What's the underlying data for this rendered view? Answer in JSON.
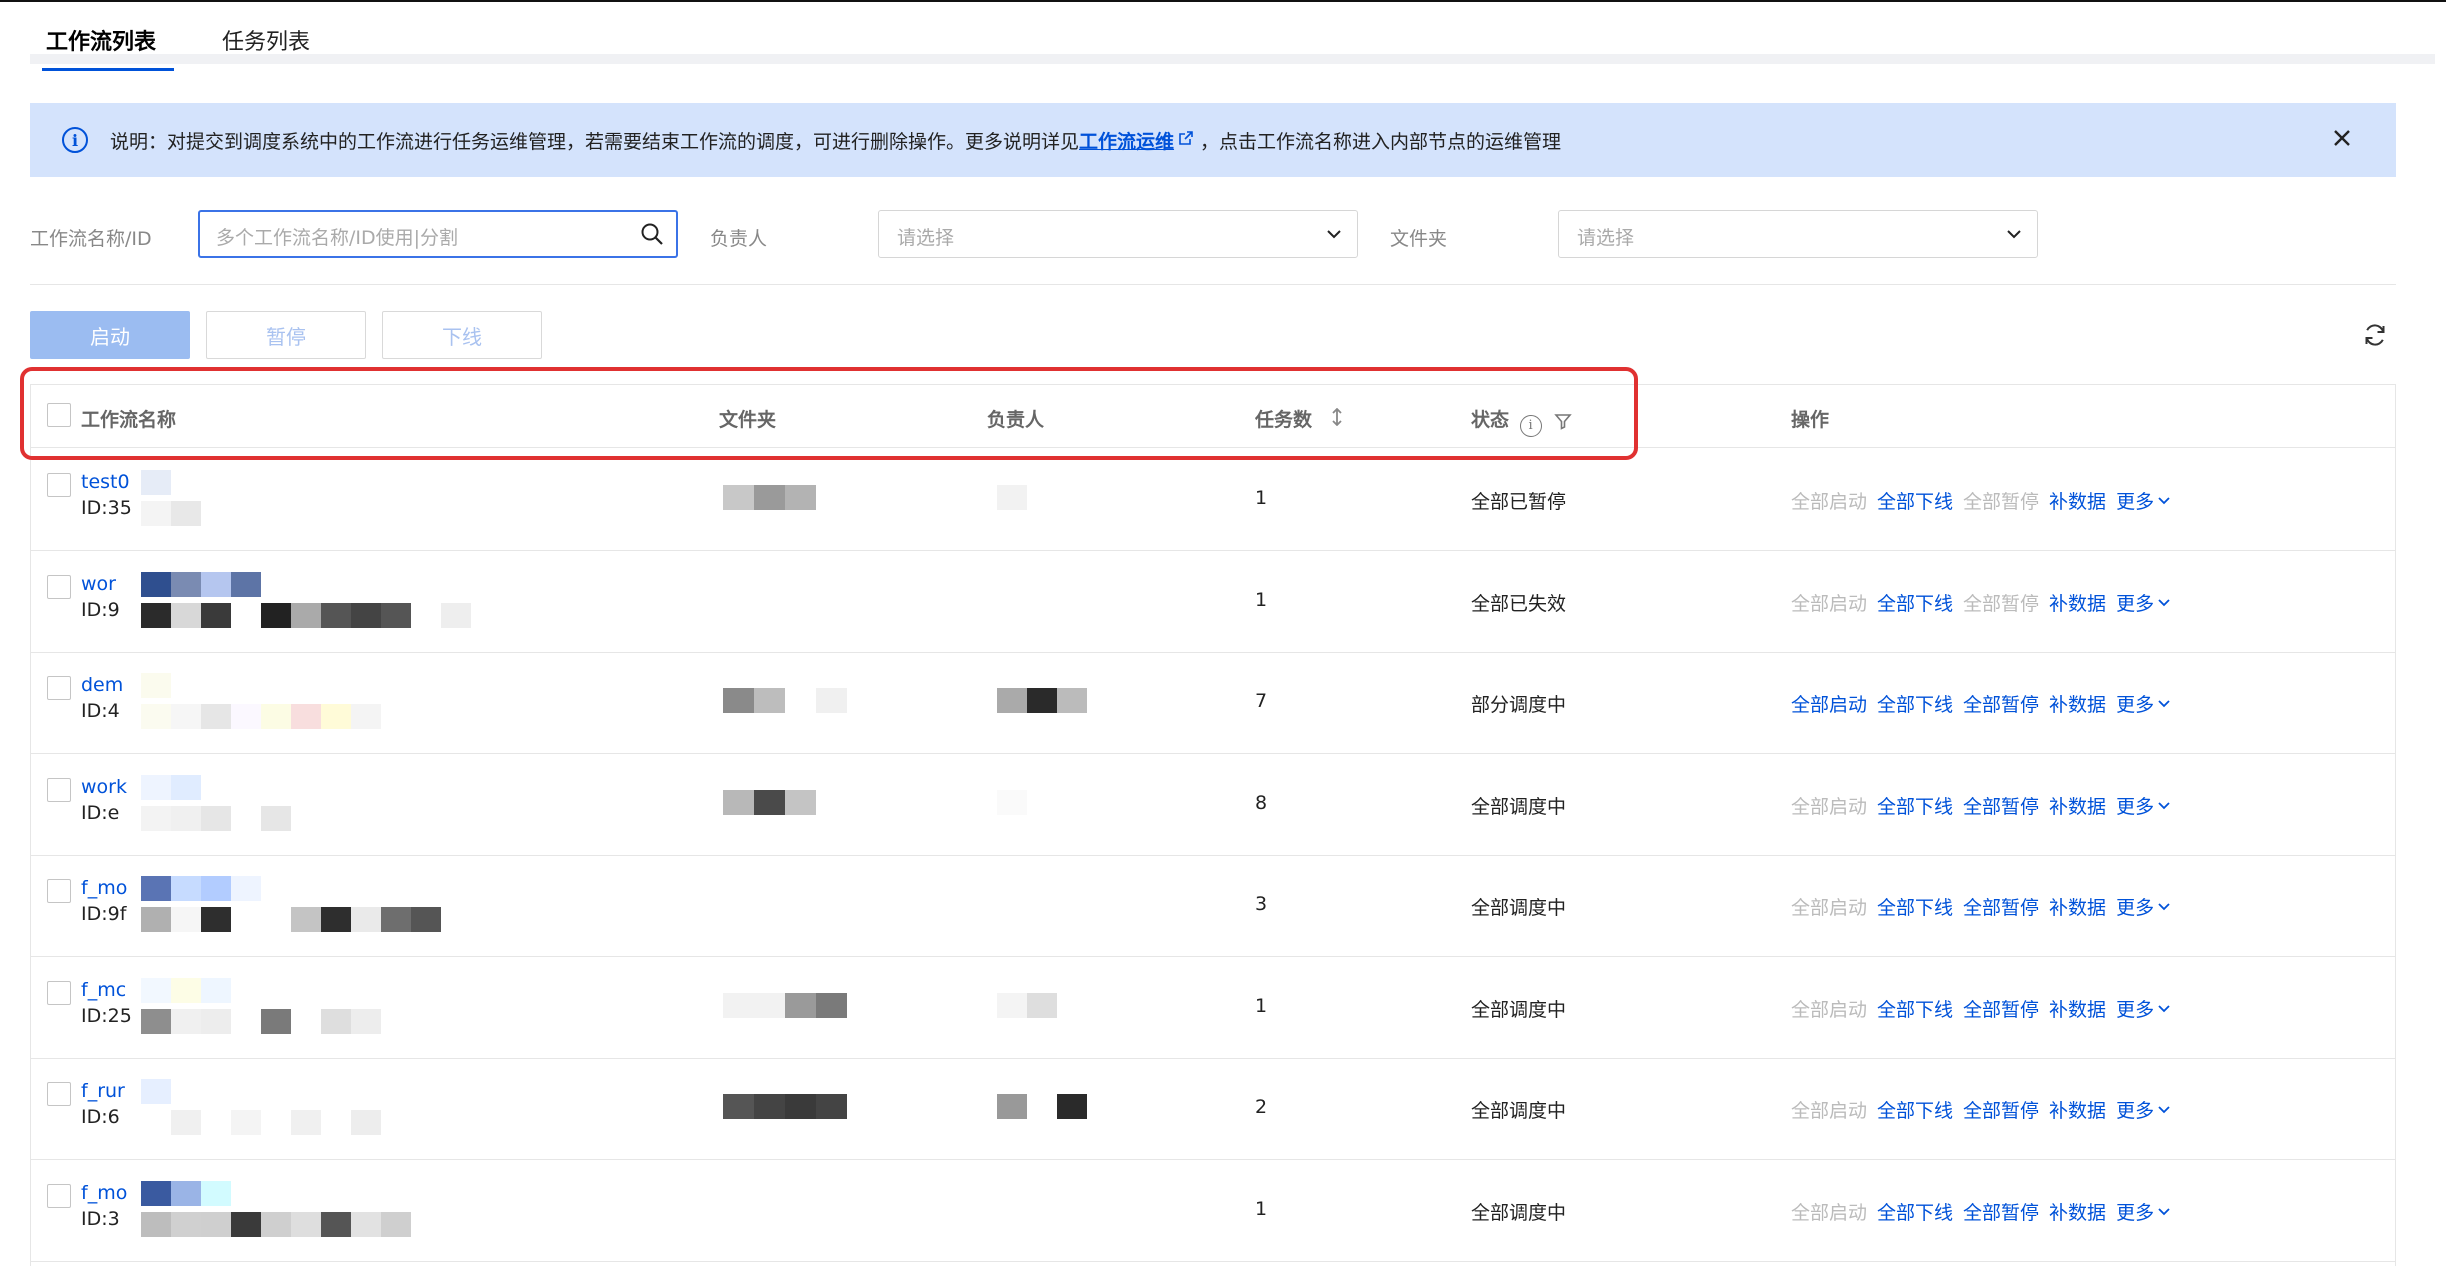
{
  "tabs": [
    {
      "label": "工作流列表",
      "active": true
    },
    {
      "label": "任务列表",
      "active": false
    }
  ],
  "notice": {
    "text_before": "说明：对提交到调度系统中的工作流进行任务运维管理，若需要结束工作流的调度，可进行删除操作。更多说明详见",
    "link": "工作流运维",
    "text_after": "，点击工作流名称进入内部节点的运维管理"
  },
  "filters": {
    "workflow_label": "工作流名称/ID",
    "workflow_placeholder": "多个工作流名称/ID使用|分割",
    "owner_label": "负责人",
    "owner_placeholder": "请选择",
    "folder_label": "文件夹",
    "folder_placeholder": "请选择"
  },
  "actions": {
    "start": "启动",
    "pause": "暂停",
    "offline": "下线"
  },
  "table": {
    "columns": {
      "name": "工作流名称",
      "folder": "文件夹",
      "owner": "负责人",
      "task_count": "任务数",
      "status": "状态",
      "ops": "操作"
    },
    "op_labels": {
      "start_all": "全部启动",
      "offline_all": "全部下线",
      "pause_all": "全部暂停",
      "backfill": "补数据",
      "more": "更多"
    },
    "rows": [
      {
        "name": "test0",
        "id": "ID:35",
        "count": "1",
        "status": "全部已暂停",
        "start": false,
        "offline": true,
        "pause": false
      },
      {
        "name": "wor",
        "id": "ID:9",
        "count": "1",
        "status": "全部已失效",
        "start": false,
        "offline": true,
        "pause": false
      },
      {
        "name": "dem",
        "id": "ID:4",
        "count": "7",
        "status": "部分调度中",
        "start": true,
        "offline": true,
        "pause": true
      },
      {
        "name": "work",
        "id": "ID:e",
        "count": "8",
        "status": "全部调度中",
        "start": false,
        "offline": true,
        "pause": true
      },
      {
        "name": "f_mo",
        "id": "ID:9f",
        "count": "3",
        "status": "全部调度中",
        "start": false,
        "offline": true,
        "pause": true
      },
      {
        "name": "f_mc",
        "id": "ID:25",
        "count": "1",
        "status": "全部调度中",
        "start": false,
        "offline": true,
        "pause": true
      },
      {
        "name": "f_rur",
        "id": "ID:6",
        "count": "2",
        "status": "全部调度中",
        "start": false,
        "offline": true,
        "pause": true
      },
      {
        "name": "f_mo",
        "id": "ID:3",
        "count": "1",
        "status": "全部调度中",
        "start": false,
        "offline": true,
        "pause": true
      }
    ]
  }
}
